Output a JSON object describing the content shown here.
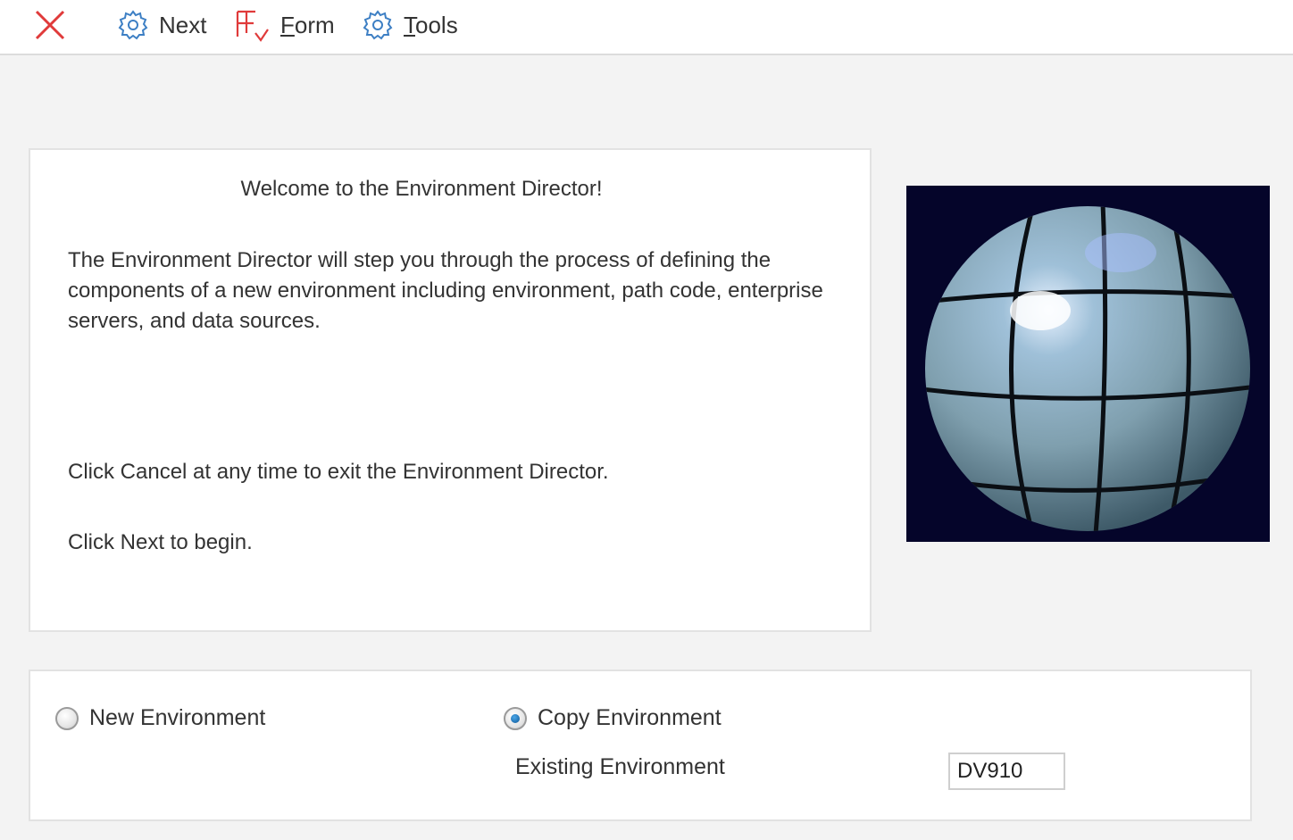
{
  "toolbar": {
    "close_icon": "close-x-icon",
    "next_label": "Next",
    "form_label_first": "F",
    "form_label_rest": "orm",
    "tools_label_first": "T",
    "tools_label_rest": "ools",
    "accent_color": "#e03a3a",
    "icon_color": "#3d7fc4"
  },
  "welcome": {
    "title": "Welcome to the Environment Director!",
    "description": "The Environment Director will step you through the process of defining the components of a new environment including environment, path code, enterprise servers, and data sources.",
    "cancel_hint": "Click Cancel at any time to exit the Environment Director.",
    "next_hint": "Click Next to begin."
  },
  "image": {
    "name": "globe-image",
    "background": "#05052a"
  },
  "options": {
    "new_environment_label": "New Environment",
    "new_environment_selected": false,
    "copy_environment_label": "Copy Environment",
    "copy_environment_selected": true,
    "existing_environment_label": "Existing Environment",
    "existing_environment_value": "DV910"
  }
}
